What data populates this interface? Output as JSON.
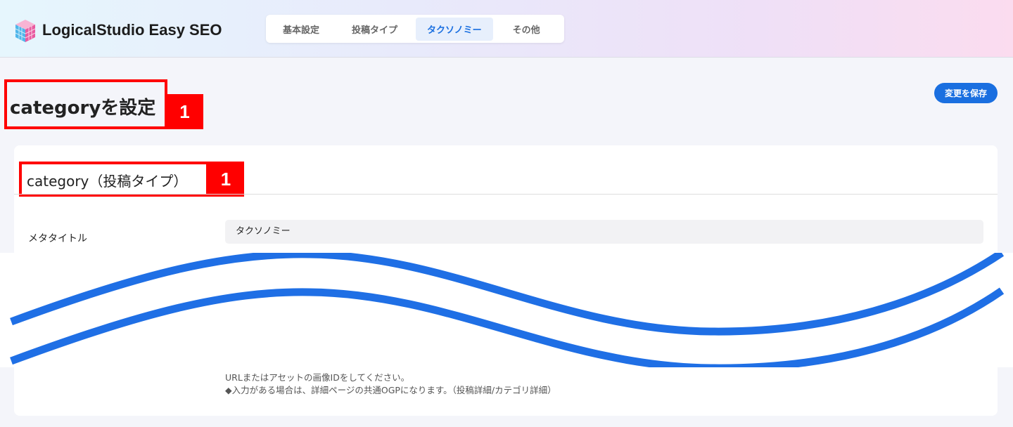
{
  "header": {
    "app_name": "LogicalStudio Easy SEO",
    "tabs": [
      {
        "label": "基本設定"
      },
      {
        "label": "投稿タイプ"
      },
      {
        "label": "タクソノミー",
        "active": true
      },
      {
        "label": "その他"
      }
    ]
  },
  "page": {
    "title": "categoryを設定",
    "save_label": "変更を保存"
  },
  "card": {
    "title": "category（投稿タイプ）",
    "field_label": "メタタイトル",
    "field_value": "タクソノミー",
    "help_lines": [
      "URLまたはアセットの画像IDをしてください。",
      "◆入力がある場合は、詳細ページの共通OGPになります。（投稿詳細/カテゴリ詳細）"
    ]
  },
  "annotations": {
    "title_badge": "1",
    "card_badge": "1",
    "color": "#ff0000"
  },
  "colors": {
    "accent": "#1a6fe0",
    "cut_line": "#1f6fe5"
  }
}
